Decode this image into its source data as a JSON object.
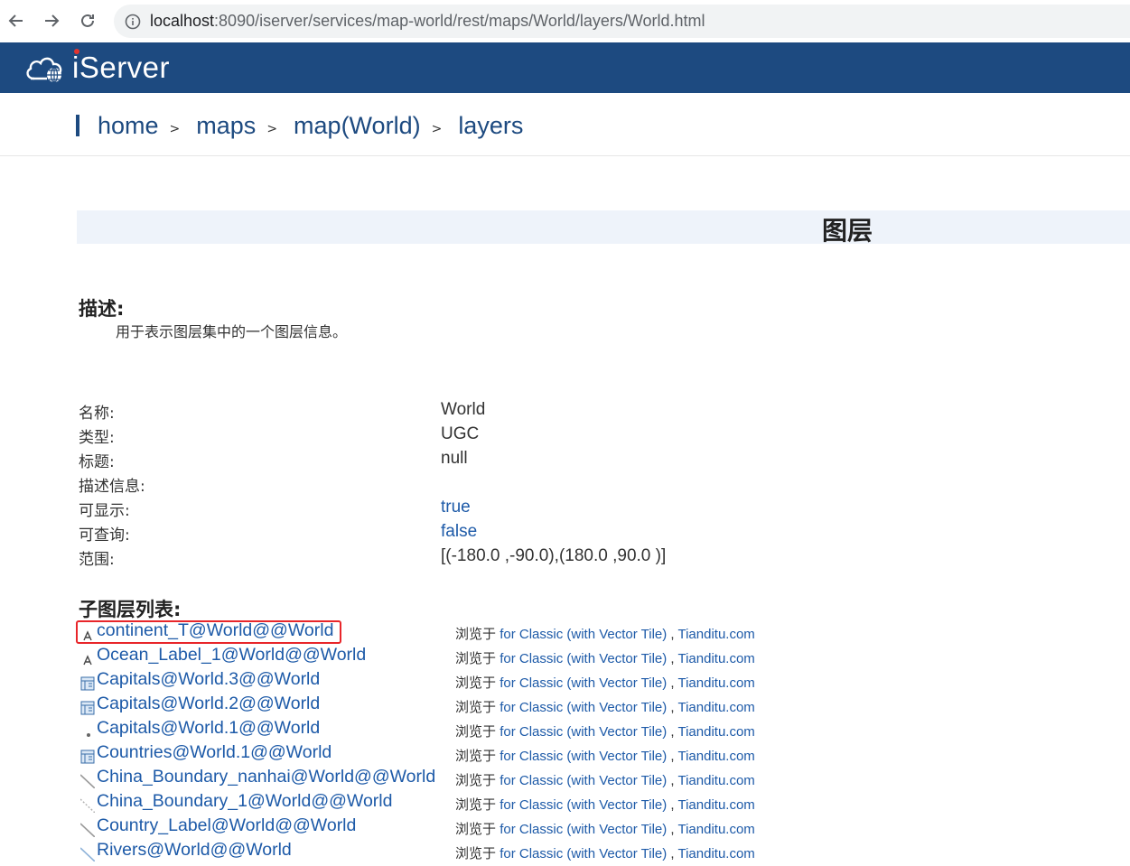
{
  "browser": {
    "url_host": "localhost",
    "url_rest": ":8090/iserver/services/map-world/rest/maps/World/layers/World.html"
  },
  "header": {
    "logo_text": "iServer",
    "bg_color": "#1d4a80"
  },
  "breadcrumb": [
    {
      "label": "home"
    },
    {
      "label": "maps"
    },
    {
      "label": "map(World)"
    },
    {
      "label": "layers"
    }
  ],
  "breadcrumb_sep": ">",
  "page": {
    "title": "图层",
    "description_heading": "描述:",
    "description": "用于表示图层集中的一个图层信息。"
  },
  "properties": [
    {
      "label": "名称:",
      "value": "World",
      "link": false
    },
    {
      "label": "类型:",
      "value": "UGC",
      "link": false
    },
    {
      "label": "标题:",
      "value": "null",
      "link": false
    },
    {
      "label": "描述信息:",
      "value": "",
      "link": false
    },
    {
      "label": "可显示:",
      "value": "true",
      "link": true
    },
    {
      "label": "可查询:",
      "value": "false",
      "link": true
    },
    {
      "label": "范围:",
      "value": "[(-180.0 ,-90.0),(180.0 ,90.0 )]",
      "link": false
    }
  ],
  "sublayers_heading": "子图层列表:",
  "browse_prefix": "浏览于",
  "browse_option_1": "for Classic (with Vector Tile)",
  "browse_sep": ",",
  "browse_option_2": "Tianditu.com",
  "sublayers": [
    {
      "name": "continent_T@World@@World",
      "icon": "text-layer-icon"
    },
    {
      "name": "Ocean_Label_1@World@@World",
      "icon": "text-layer-icon"
    },
    {
      "name": "Capitals@World.3@@World",
      "icon": "theme-layer-icon"
    },
    {
      "name": "Capitals@World.2@@World",
      "icon": "theme-layer-icon"
    },
    {
      "name": "Capitals@World.1@@World",
      "icon": "point-layer-icon"
    },
    {
      "name": "Countries@World.1@@World",
      "icon": "theme-layer-icon"
    },
    {
      "name": "China_Boundary_nanhai@World@@World",
      "icon": "line-layer-icon"
    },
    {
      "name": "China_Boundary_1@World@@World",
      "icon": "dashed-line-layer-icon"
    },
    {
      "name": "Country_Label@World@@World",
      "icon": "line-layer-icon"
    },
    {
      "name": "Rivers@World@@World",
      "icon": "river-line-layer-icon"
    }
  ],
  "colors": {
    "link": "#1d5aa8",
    "highlight": "#e8262a",
    "title_band": "#eef3fa"
  }
}
